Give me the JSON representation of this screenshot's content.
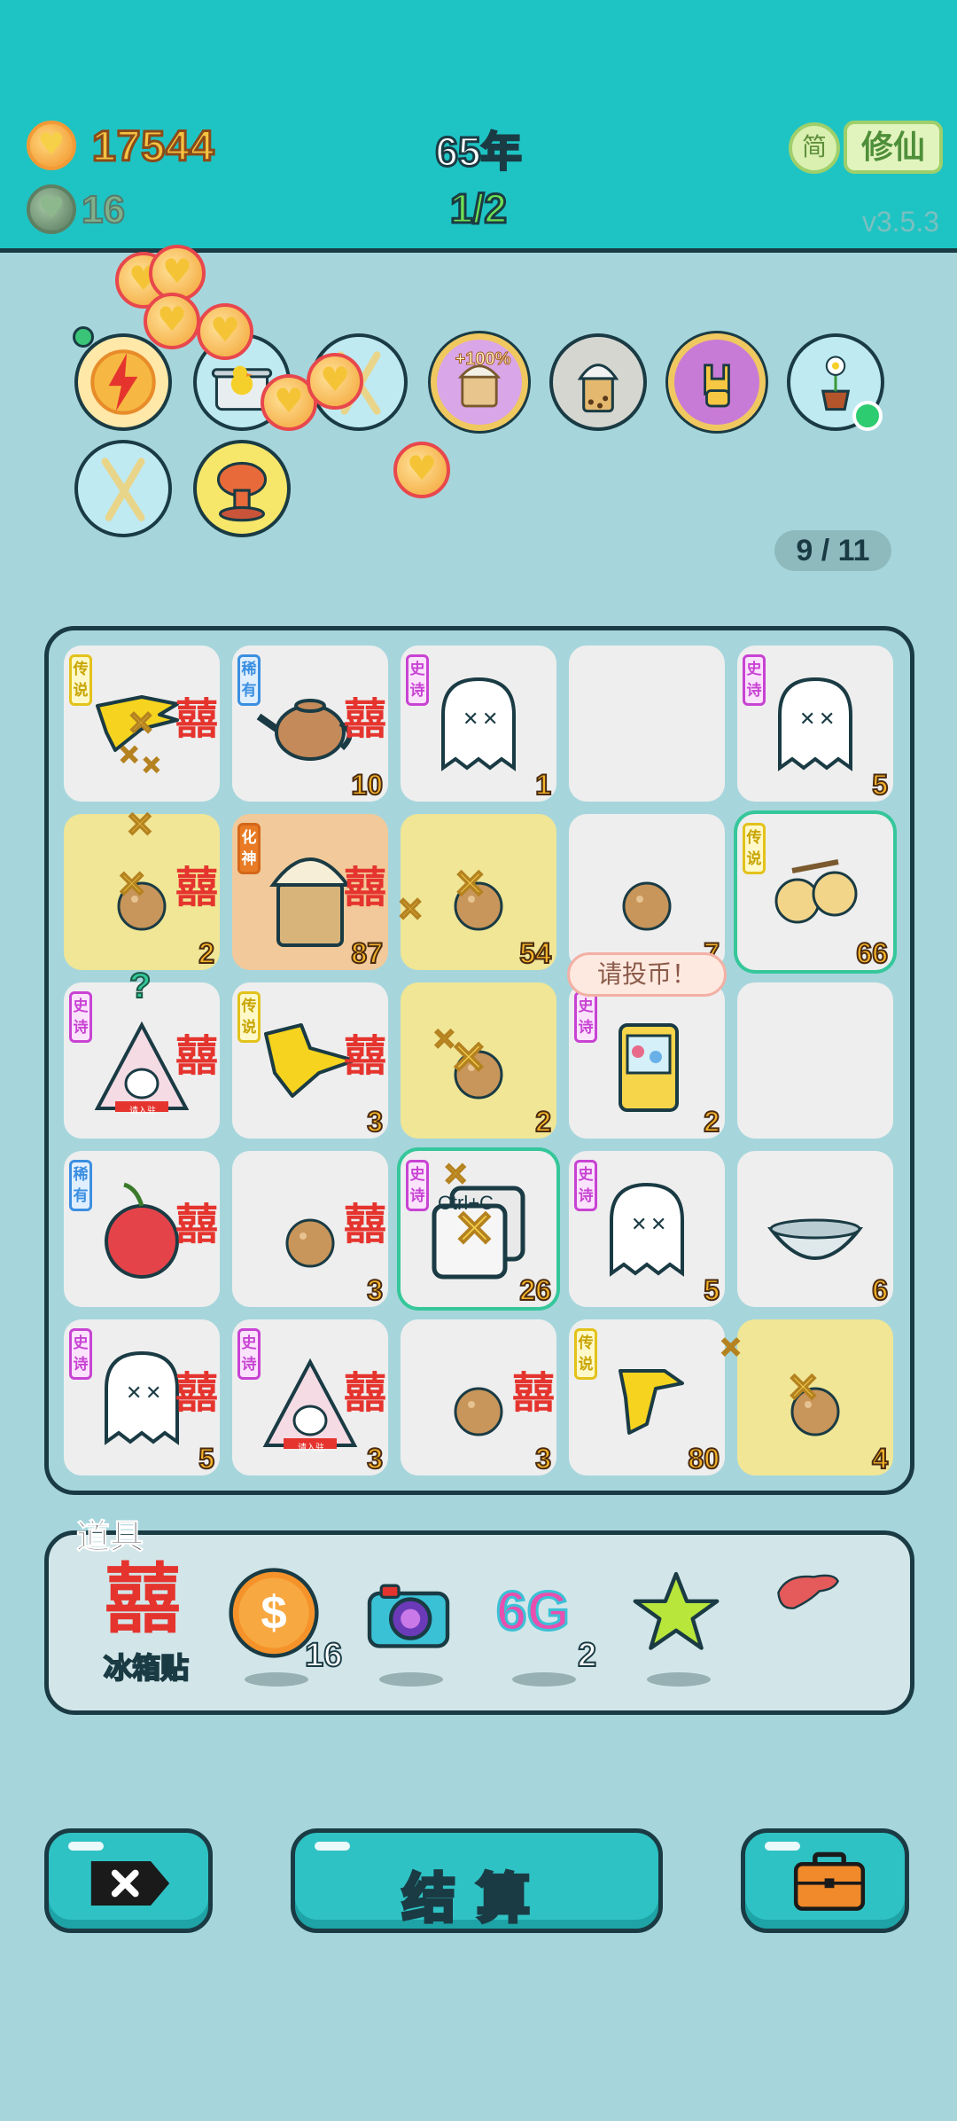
{
  "header": {
    "money": "17544",
    "gray_count": "16",
    "year": "65年",
    "round": "1/2",
    "simplified_label": "简",
    "cultivate_label": "修仙",
    "version": "v3.5.3"
  },
  "relics": {
    "percent_label": "+100%",
    "page": "9 / 11"
  },
  "board": {
    "cells": [
      {
        "rarity": "传说",
        "xi": "囍",
        "num": ""
      },
      {
        "rarity": "稀有",
        "xi": "囍",
        "num": "10"
      },
      {
        "rarity": "史诗",
        "xi": "",
        "num": "1"
      },
      {
        "rarity": "",
        "xi": "",
        "num": ""
      },
      {
        "rarity": "史诗",
        "xi": "",
        "num": "5"
      },
      {
        "rarity": "",
        "xi": "囍",
        "num": "2"
      },
      {
        "rarity": "化神",
        "xi": "囍",
        "num": "87"
      },
      {
        "rarity": "",
        "xi": "",
        "num": "54"
      },
      {
        "rarity": "",
        "xi": "",
        "num": "7"
      },
      {
        "rarity": "传说",
        "xi": "",
        "num": "66"
      },
      {
        "rarity": "史诗",
        "xi": "囍",
        "num": ""
      },
      {
        "rarity": "传说",
        "xi": "囍",
        "num": "3"
      },
      {
        "rarity": "",
        "xi": "",
        "num": "2"
      },
      {
        "rarity": "史诗",
        "xi": "",
        "num": "2"
      },
      {
        "rarity": "",
        "xi": "",
        "num": ""
      },
      {
        "rarity": "稀有",
        "xi": "囍",
        "num": ""
      },
      {
        "rarity": "",
        "xi": "囍",
        "num": "3"
      },
      {
        "rarity": "史诗",
        "xi": "",
        "num": "26"
      },
      {
        "rarity": "史诗",
        "xi": "",
        "num": "5"
      },
      {
        "rarity": "",
        "xi": "",
        "num": "6"
      },
      {
        "rarity": "史诗",
        "xi": "囍",
        "num": "5"
      },
      {
        "rarity": "史诗",
        "xi": "囍",
        "num": "3"
      },
      {
        "rarity": "",
        "xi": "囍",
        "num": "3"
      },
      {
        "rarity": "传说",
        "xi": "",
        "num": "80"
      },
      {
        "rarity": "",
        "xi": "",
        "num": "4"
      }
    ],
    "speech": "请投币！",
    "copy_label": "Ctrl+C",
    "question": "?",
    "lantern_sign": "请入驻"
  },
  "items": {
    "title": "道具",
    "fridge_label": "冰箱贴",
    "xi_glyph": "囍",
    "coin_count": "16",
    "network_label": "6G",
    "network_count": "2"
  },
  "buttons": {
    "settle_label": "结算"
  },
  "colors": {
    "background": "#a6d6dc",
    "header": "#1ec4c4",
    "accent_gold": "#f6c342",
    "round_green": "#6ee052",
    "xi_red": "#e5342e"
  }
}
